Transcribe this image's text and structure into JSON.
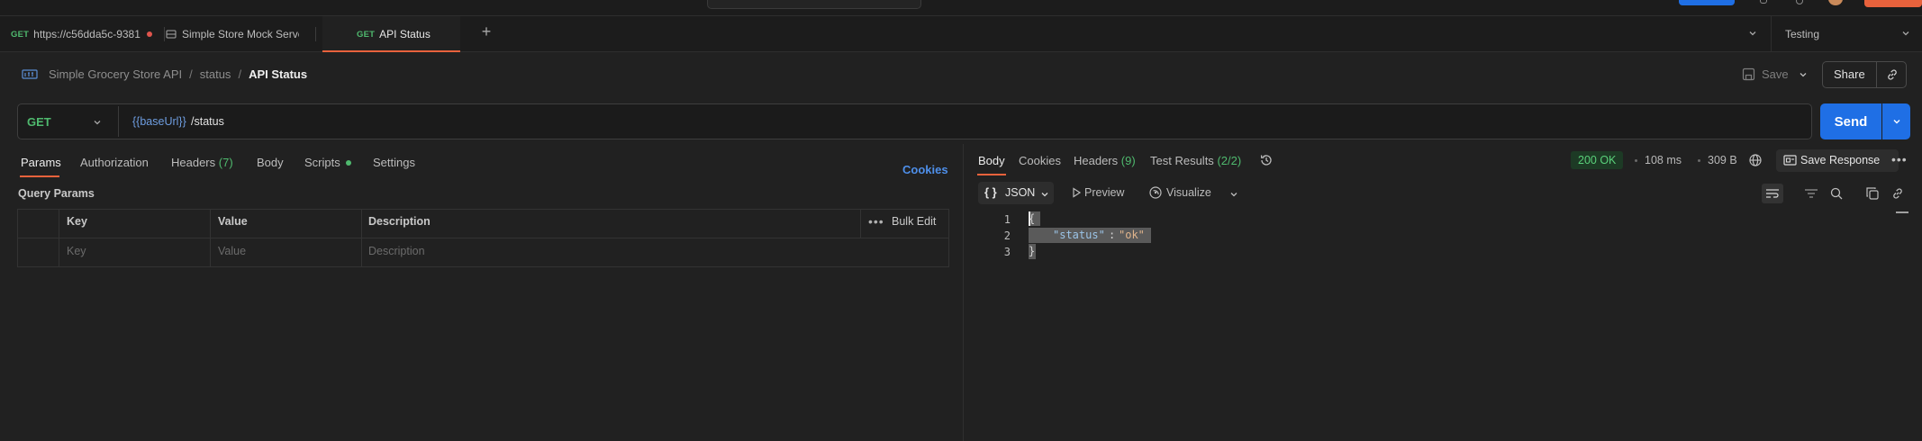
{
  "tabs": [
    {
      "method": "GET",
      "label": "https://c56dda5c-9381",
      "unsaved": true
    },
    {
      "label": "Simple Store Mock Serve"
    },
    {
      "method": "GET",
      "label": "API Status",
      "active": true
    }
  ],
  "environment": {
    "label": "Testing"
  },
  "breadcrumb": {
    "collection": "Simple Grocery Store API",
    "folder": "status",
    "request": "API Status"
  },
  "toolbar": {
    "save_label": "Save",
    "share_label": "Share"
  },
  "request": {
    "method": "GET",
    "url_variable": "{{baseUrl}}",
    "url_path": "/status",
    "send_label": "Send"
  },
  "request_tabs": {
    "params": "Params",
    "authorization": "Authorization",
    "headers": "Headers",
    "headers_count": "(7)",
    "body": "Body",
    "scripts": "Scripts",
    "settings": "Settings",
    "cookies_link": "Cookies"
  },
  "query_params": {
    "title": "Query Params",
    "columns": [
      "Key",
      "Value",
      "Description"
    ],
    "placeholders": [
      "Key",
      "Value",
      "Description"
    ],
    "bulk_edit": "Bulk Edit"
  },
  "response": {
    "tabs": {
      "body": "Body",
      "cookies": "Cookies",
      "headers": "Headers",
      "headers_count": "(9)",
      "test_results": "Test Results",
      "test_results_count": "(2/2)"
    },
    "status": "200 OK",
    "time": "108 ms",
    "size": "309 B",
    "save_response": "Save Response",
    "format": "JSON",
    "preview": "Preview",
    "visualize": "Visualize",
    "lines": [
      "1",
      "2",
      "3"
    ],
    "code": {
      "open": "{",
      "key": "\"status\"",
      "colon": ":",
      "value": "\"ok\"",
      "close": "}"
    }
  },
  "colors": {
    "accent": "#e8623c",
    "primary": "#1f6fe5",
    "success": "#4fb96e"
  }
}
